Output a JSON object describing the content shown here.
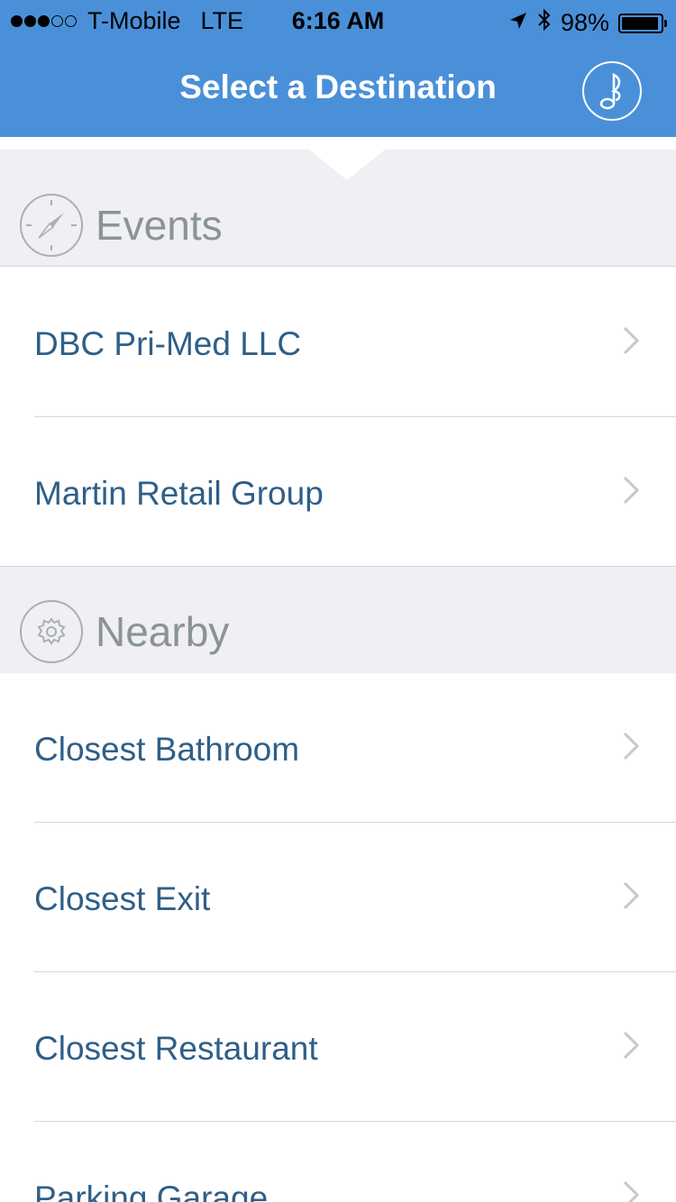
{
  "status_bar": {
    "carrier": "T-Mobile",
    "network": "LTE",
    "time": "6:16 AM",
    "battery": "98%"
  },
  "nav": {
    "title": "Select a Destination"
  },
  "sections": [
    {
      "label": "Events",
      "icon": "compass-icon",
      "items": [
        "DBC Pri-Med LLC",
        "Martin Retail Group"
      ]
    },
    {
      "label": "Nearby",
      "icon": "gear-icon",
      "items": [
        "Closest Bathroom",
        "Closest Exit",
        "Closest Restaurant",
        "Parking Garage"
      ]
    }
  ],
  "colors": {
    "nav_bar": "#4a90d9",
    "item_text": "#2f5f88",
    "header_text": "#8a9494",
    "header_bg": "#efeff4"
  }
}
